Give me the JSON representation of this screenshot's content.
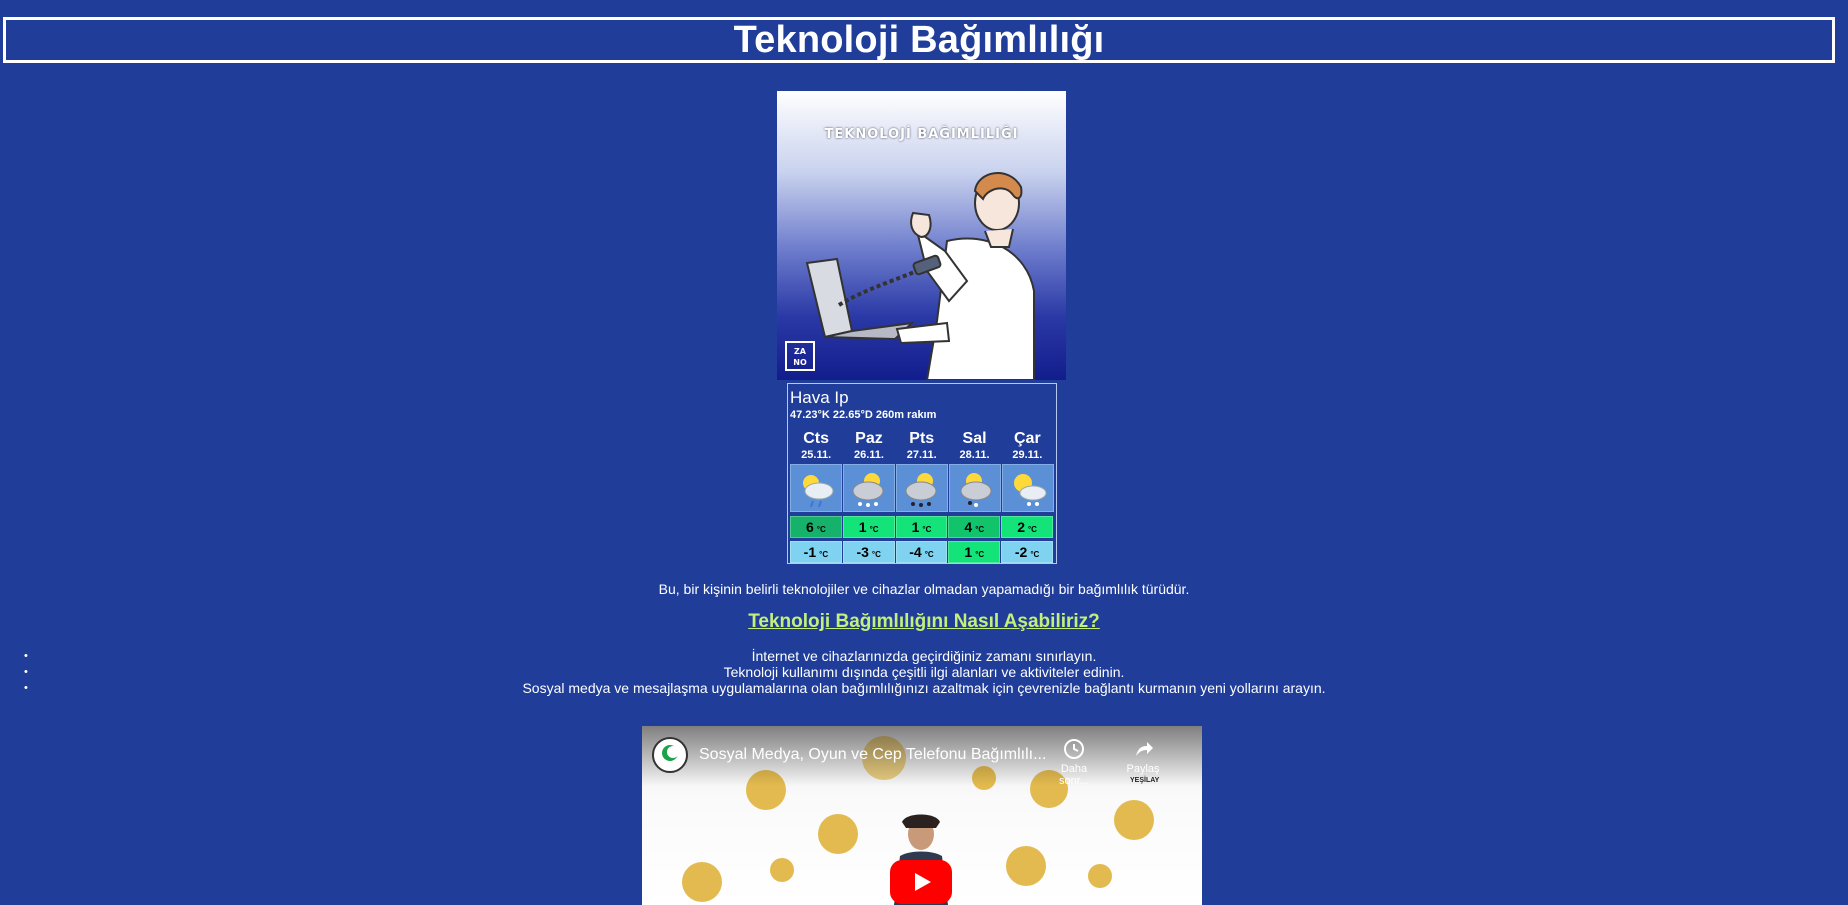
{
  "page": {
    "title": "Teknoloji Bağımlılığı"
  },
  "poster": {
    "headline": "TEKNOLOJİ BAĞIMLILIĞI",
    "logo_line1": "ZA",
    "logo_line2": "NO"
  },
  "weather": {
    "city": "Hava Ip",
    "coords": "47.23°K 22.65°D 260m rakım",
    "unit": "°C",
    "days": [
      {
        "name": "Cts",
        "date": "25.11.",
        "hi": "6",
        "lo": "-1",
        "icon": "sun-cloud-rain-icon",
        "hi_color": "#16b26b",
        "lo_color": "#7fd3f0"
      },
      {
        "name": "Paz",
        "date": "26.11.",
        "hi": "1",
        "lo": "-3",
        "icon": "sun-cloud-snow-icon",
        "hi_color": "#14e37a",
        "lo_color": "#7fd3f0"
      },
      {
        "name": "Pts",
        "date": "27.11.",
        "hi": "1",
        "lo": "-4",
        "icon": "sun-cloud-rain-icon",
        "hi_color": "#14e37a",
        "lo_color": "#7fd3f0"
      },
      {
        "name": "Sal",
        "date": "28.11.",
        "hi": "4",
        "lo": "1",
        "icon": "sun-cloud-snow-icon",
        "hi_color": "#11c46c",
        "lo_color": "#14e37a"
      },
      {
        "name": "Çar",
        "date": "29.11.",
        "hi": "2",
        "lo": "-2",
        "icon": "sun-cloud-snow-icon",
        "hi_color": "#14e37a",
        "lo_color": "#7fd3f0"
      }
    ]
  },
  "content": {
    "intro": "Bu, bir kişinin belirli teknolojiler ve cihazlar olmadan yapamadığı bir bağımlılık türüdür.",
    "howto_heading": "Teknoloji Bağımlılığını Nasıl Aşabiliriz?",
    "tips": [
      "İnternet ve cihazlarınızda geçirdiğiniz zamanı sınırlayın.",
      "Teknoloji kullanımı dışında çeşitli ilgi alanları ve aktiviteler edinin.",
      "Sosyal medya ve mesajlaşma uygulamalarına olan bağımlılığınızı azaltmak için çevrenizle bağlantı kurmanın yeni yollarını arayın."
    ],
    "bullet": "•"
  },
  "video": {
    "title": "Sosyal Medya, Oyun ve Cep Telefonu Bağımlılı...",
    "watch_later": "Daha sonr...",
    "share": "Paylaş",
    "channel_badge": "YEŞİLAY"
  },
  "colors": {
    "background": "#1f3d99",
    "heading_accent": "#c3f07a"
  }
}
